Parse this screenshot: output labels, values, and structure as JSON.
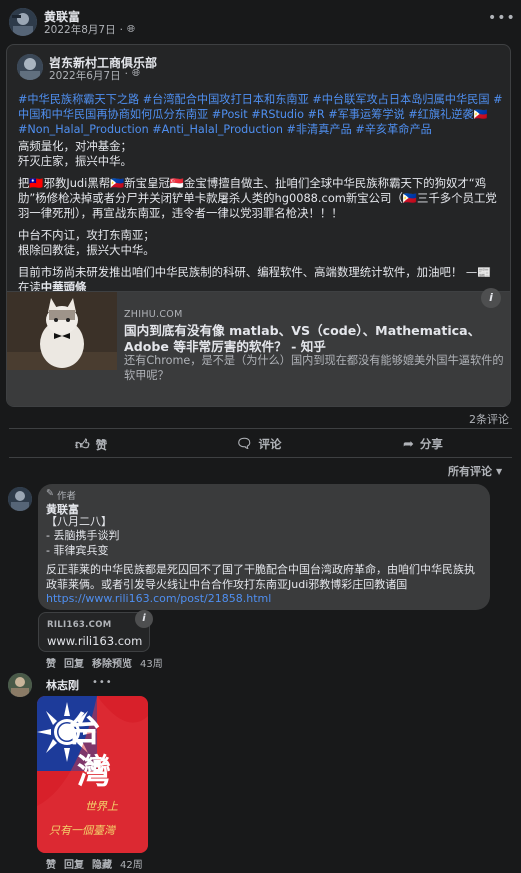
{
  "author": {
    "name": "黄联富",
    "date": "2022年8月7日",
    "visibility_icon": "globe-icon"
  },
  "shared_post": {
    "page_name": "岧东新村工商俱乐部",
    "date": "2022年6月7日",
    "hashtags": "#中华民族称霸天下之路 #台湾配合中国攻打日本和东南亚 #中台联军攻占日本岛归属中华民国 #中国和中华民国再协商如何瓜分东南亚 #Posit #RStudio #R #军事运筹学说 #红旗礼逆袭🇵🇭 #Non_Halal_Production #Anti_Halal_Production #非清真产品 #辛亥革命产品",
    "p1a": "高频量化，对冲基金；",
    "p1b": "歼灭庄家，振兴中华。",
    "p2": "把🇹🇼邪教Judi黑帮🇵🇭新宝皇冠🇸🇬金宝博擅自做主、扯咱们全球中华民族称霸天下的狗奴才“鸡肋”杨修枪决掉或者分尸并关闭铲单卡款屠杀人类的hg0088.com新宝公司（🇵🇭三千多个员工党羽一律死刑），再宣战东南亚，违令者一律以党羽罪名枪决！！！",
    "p3a": "中台不内讧，攻打东南亚；",
    "p3b": "根除回教徒，振兴大中华。",
    "p4": "目前市场尚未研发推出咱们中华民族制的科研、编程软件、高端数理统计软件，加油吧！ —📰",
    "p4b_prefix": "在读",
    "p4b_bold": "中華頭條",
    "link": {
      "domain": "ZHIHU.COM",
      "title": "国内到底有没有像 matlab、VS（code）、Mathematica、Adobe 等非常厉害的软件？ - 知乎",
      "subtitle": "还有Chrome，是不是（为什么）国内到现在都没有能够媲美外国牛逼软件的软甲呢？",
      "info": "i"
    }
  },
  "comment_count": "2条评论",
  "actions": {
    "like": "赞",
    "comment": "评论",
    "share": "分享"
  },
  "sort_label": "所有评论",
  "comments": [
    {
      "badge": "作者",
      "name": "黄联富",
      "l1": "【八月二八】",
      "l2": "- 丢脑携手谈判",
      "l3": "- 菲律宾兵变",
      "l4": "反正菲莱的中华民族都是死囚回不了国了干脆配合中国台湾政府革命，由咱们中华民族执政菲莱俩。或者引发导火线让中台合作攻打东南亚Judi邪教博彩庄回教诸国",
      "url": "https://www.rili163.com/post/21858.html",
      "preview_domain": "RILI163.COM",
      "preview_url": "www.rili163.com",
      "like": "赞",
      "reply": "回复",
      "remove": "移除预览",
      "time": "43周"
    },
    {
      "name": "林志刚",
      "flag_text_1": "台",
      "flag_text_2": "灣",
      "flag_text_3": "世界上",
      "flag_text_4": "只有一個臺灣",
      "like": "赞",
      "reply": "回复",
      "hide": "隐藏",
      "time": "42周"
    }
  ]
}
